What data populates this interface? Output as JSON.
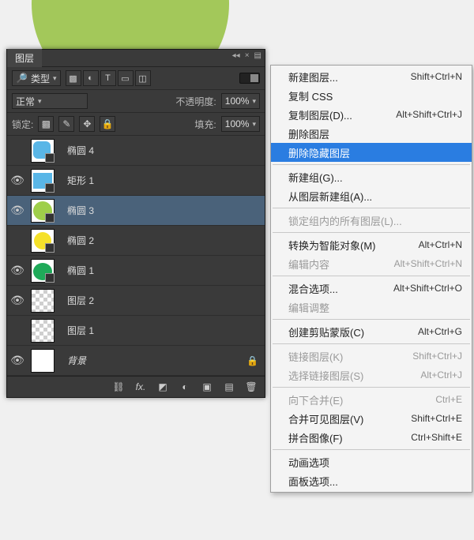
{
  "panel": {
    "title": "图层",
    "type_label": "类型",
    "blend_mode": "正常",
    "opacity_label": "不透明度:",
    "opacity_value": "100%",
    "lock_label": "锁定:",
    "fill_label": "填充:",
    "fill_value": "100%"
  },
  "layers": [
    {
      "name": "椭圆 4",
      "visible": false,
      "thumbClass": "t0",
      "hasVector": true
    },
    {
      "name": "矩形 1",
      "visible": true,
      "thumbClass": "t1",
      "hasVector": true
    },
    {
      "name": "椭圆 3",
      "visible": true,
      "thumbClass": "t2",
      "hasVector": true,
      "selected": true
    },
    {
      "name": "椭圆 2",
      "visible": false,
      "thumbClass": "t3",
      "hasVector": true
    },
    {
      "name": "椭圆 1",
      "visible": true,
      "thumbClass": "t4",
      "hasVector": true
    },
    {
      "name": "图层 2",
      "visible": true,
      "thumbClass": "thumb-checker",
      "hasVector": false
    },
    {
      "name": "图层 1",
      "visible": false,
      "thumbClass": "thumb-checker",
      "hasVector": false
    },
    {
      "name": "背景",
      "visible": true,
      "thumbClass": "t7",
      "hasVector": false,
      "locked": true,
      "italic": true
    }
  ],
  "footer_icons": [
    "chain-icon",
    "fx-icon",
    "mask-icon",
    "adjust-icon",
    "folder-icon",
    "new-icon",
    "trash-icon"
  ],
  "context_menu": [
    {
      "label": "新建图层...",
      "shortcut": "Shift+Ctrl+N"
    },
    {
      "label": "复制 CSS"
    },
    {
      "label": "复制图层(D)...",
      "shortcut": "Alt+Shift+Ctrl+J"
    },
    {
      "label": "删除图层"
    },
    {
      "label": "删除隐藏图层",
      "hover": true
    },
    {
      "sep": true
    },
    {
      "label": "新建组(G)..."
    },
    {
      "label": "从图层新建组(A)..."
    },
    {
      "sep": true
    },
    {
      "label": "锁定组内的所有图层(L)...",
      "disabled": true
    },
    {
      "sep": true
    },
    {
      "label": "转换为智能对象(M)",
      "shortcut": "Alt+Ctrl+N"
    },
    {
      "label": "编辑内容",
      "shortcut": "Alt+Shift+Ctrl+N",
      "disabled": true
    },
    {
      "sep": true
    },
    {
      "label": "混合选项...",
      "shortcut": "Alt+Shift+Ctrl+O"
    },
    {
      "label": "编辑调整",
      "disabled": true
    },
    {
      "sep": true
    },
    {
      "label": "创建剪贴蒙版(C)",
      "shortcut": "Alt+Ctrl+G"
    },
    {
      "sep": true
    },
    {
      "label": "链接图层(K)",
      "shortcut": "Shift+Ctrl+J",
      "disabled": true
    },
    {
      "label": "选择链接图层(S)",
      "shortcut": "Alt+Ctrl+J",
      "disabled": true
    },
    {
      "sep": true
    },
    {
      "label": "向下合并(E)",
      "shortcut": "Ctrl+E",
      "disabled": true
    },
    {
      "label": "合并可见图层(V)",
      "shortcut": "Shift+Ctrl+E"
    },
    {
      "label": "拼合图像(F)",
      "shortcut": "Ctrl+Shift+E"
    },
    {
      "sep": true
    },
    {
      "label": "动画选项"
    },
    {
      "label": "面板选项..."
    }
  ]
}
